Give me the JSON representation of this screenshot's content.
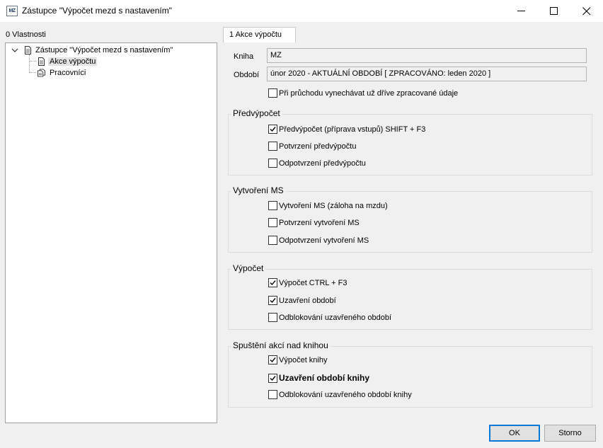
{
  "window": {
    "title": "Zástupce \"Výpočet mezd s nastavením\"",
    "app_icon_text": "MZ"
  },
  "left_panel": {
    "tab_label": "0 Vlastnosti",
    "tree": {
      "root_label": "Zástupce \"Výpočet mezd s nastavením\"",
      "children": [
        {
          "label": "Akce výpočtu",
          "selected": true
        },
        {
          "label": "Pracovníci",
          "selected": false
        }
      ]
    }
  },
  "right_panel": {
    "tab_label": "1 Akce výpočtu",
    "fields": {
      "kniha_label": "Kniha",
      "kniha_value": "MZ",
      "obdobi_label": "Období",
      "obdobi_value": "únor 2020 - AKTUÁLNÍ OBDOBÍ [ ZPRACOVÁNO: leden 2020 ]"
    },
    "skip_processed": {
      "label": "Při průchodu vynechávat už dříve zpracované údaje",
      "checked": false
    },
    "groups": [
      {
        "title": "Předvýpočet",
        "items": [
          {
            "label": "Předvýpočet (příprava vstupů) SHIFT + F3",
            "checked": true
          },
          {
            "label": "Potvrzení předvýpočtu",
            "checked": false
          },
          {
            "label": "Odpotvrzení předvýpočtu",
            "checked": false
          }
        ]
      },
      {
        "title": "Vytvoření MS",
        "items": [
          {
            "label": "Vytvoření MS (záloha na mzdu)",
            "checked": false
          },
          {
            "label": "Potvrzení vytvoření MS",
            "checked": false
          },
          {
            "label": "Odpotvrzení vytvoření MS",
            "checked": false
          }
        ]
      },
      {
        "title": "Výpočet",
        "items": [
          {
            "label": "Výpočet CTRL + F3",
            "checked": true
          },
          {
            "label": "Uzavření období",
            "checked": true
          },
          {
            "label": "Odblokování uzavřeného období",
            "checked": false
          }
        ]
      },
      {
        "title": "Spuštění akcí nad knihou",
        "items": [
          {
            "label": "Výpočet knihy",
            "checked": true
          },
          {
            "label": "Uzavření období knihy",
            "checked": true,
            "bold": true
          },
          {
            "label": "Odblokování uzavřeného období knihy",
            "checked": false
          }
        ]
      }
    ]
  },
  "buttons": {
    "ok_label": "OK",
    "cancel_label": "Storno"
  },
  "colors": {
    "accent": "#0078d7",
    "background": "#f0f0f0"
  },
  "icons": {
    "tree_root": "document-icon",
    "tree_child_1": "document-icon",
    "tree_child_2": "documents-icon"
  }
}
